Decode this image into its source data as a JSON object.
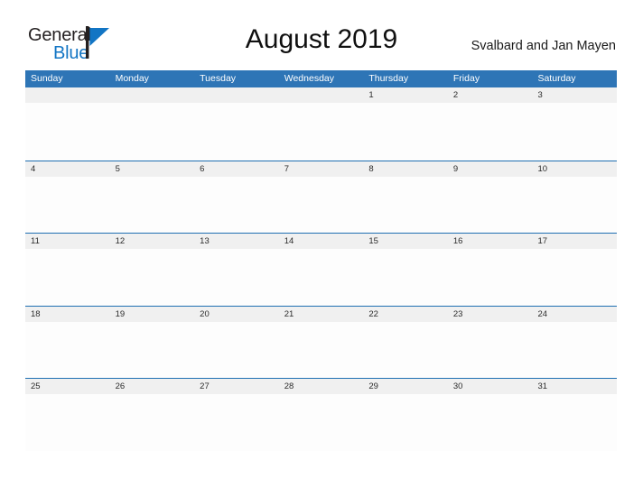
{
  "brand": {
    "name_part1": "General",
    "name_part2": "Blue",
    "flag_icon": "blue-triangle-flag-icon",
    "color_dark": "#231f20",
    "color_blue": "#1275c4"
  },
  "header": {
    "title": "August 2019",
    "subtitle": "Svalbard and Jan Mayen"
  },
  "calendar": {
    "header_bg": "#2e75b6",
    "row_line_color": "#1f6fb2",
    "daynum_band_bg": "#f0f0f0",
    "weekdays": [
      "Sunday",
      "Monday",
      "Tuesday",
      "Wednesday",
      "Thursday",
      "Friday",
      "Saturday"
    ],
    "weeks": [
      [
        "",
        "",
        "",
        "",
        "1",
        "2",
        "3"
      ],
      [
        "4",
        "5",
        "6",
        "7",
        "8",
        "9",
        "10"
      ],
      [
        "11",
        "12",
        "13",
        "14",
        "15",
        "16",
        "17"
      ],
      [
        "18",
        "19",
        "20",
        "21",
        "22",
        "23",
        "24"
      ],
      [
        "25",
        "26",
        "27",
        "28",
        "29",
        "30",
        "31"
      ]
    ]
  }
}
